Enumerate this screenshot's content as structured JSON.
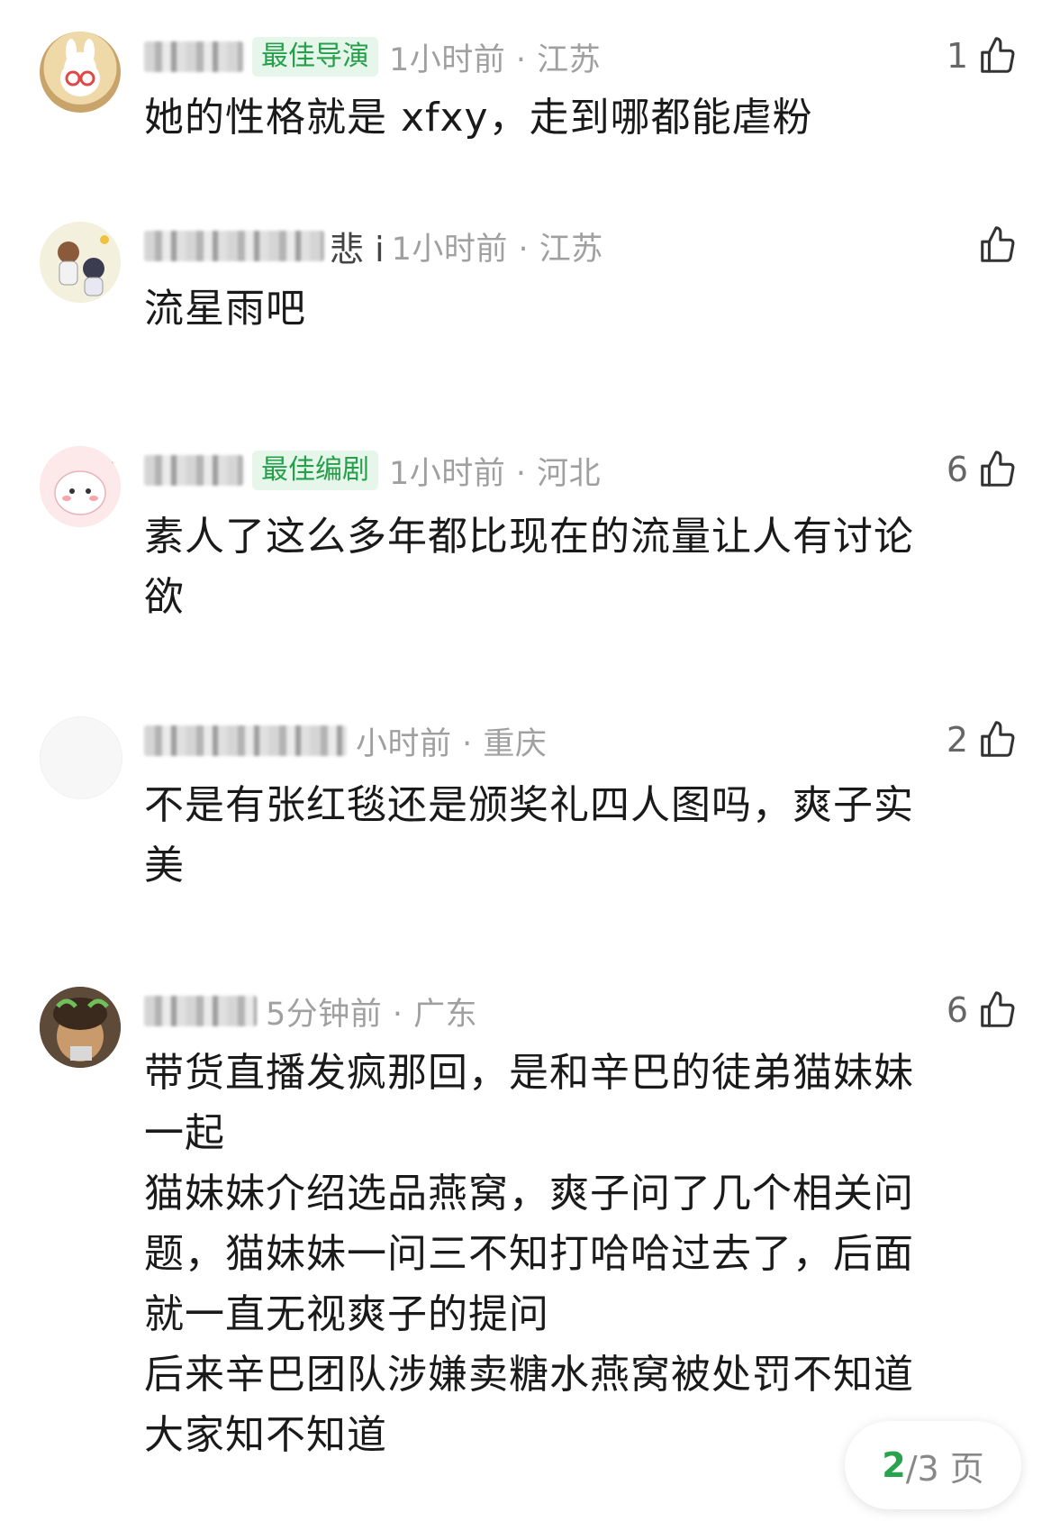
{
  "comments": [
    {
      "name_partial": "",
      "badge": "最佳导演",
      "time_location": "1小时前 · 江苏",
      "likes": "1",
      "text": "她的性格就是 xfxy，走到哪都能虐粉",
      "avatar_color": "#e7c88c"
    },
    {
      "name_partial": "悲 i",
      "badge": "",
      "time_location": "1小时前 · 江苏",
      "likes": "",
      "text": "流星雨吧",
      "avatar_color": "#e9ecd8"
    },
    {
      "name_partial": "",
      "badge": "最佳编剧",
      "time_location": "1小时前 · 河北",
      "likes": "6",
      "text": "素人了这么多年都比现在的流量让人有讨论\n欲",
      "avatar_color": "#f7d7da"
    },
    {
      "name_partial": "",
      "badge": "",
      "time_location": "小时前 · 重庆",
      "likes": "2",
      "text": "不是有张红毯还是颁奖礼四人图吗，爽子实\n美",
      "avatar_color": "#f8f8f8"
    },
    {
      "name_partial": "",
      "badge": "",
      "time_location": "5分钟前 · 广东",
      "likes": "6",
      "text": "带货直播发疯那回，是和辛巴的徒弟猫妹妹\n一起\n猫妹妹介绍选品燕窝，爽子问了几个相关问\n题，猫妹妹一问三不知打哈哈过去了，后面\n就一直无视爽子的提问\n后来辛巴团队涉嫌卖糖水燕窝被处罚不知道\n大家知不知道",
      "avatar_color": "#6b5a45"
    }
  ],
  "pager": {
    "current": "2",
    "total": "/3 页"
  },
  "colors": {
    "accent": "#25a04a",
    "meta_gray": "#a0a0a0",
    "badge_bg": "#e7f6ea"
  },
  "icons": {
    "like": "thumbs-up-icon"
  }
}
